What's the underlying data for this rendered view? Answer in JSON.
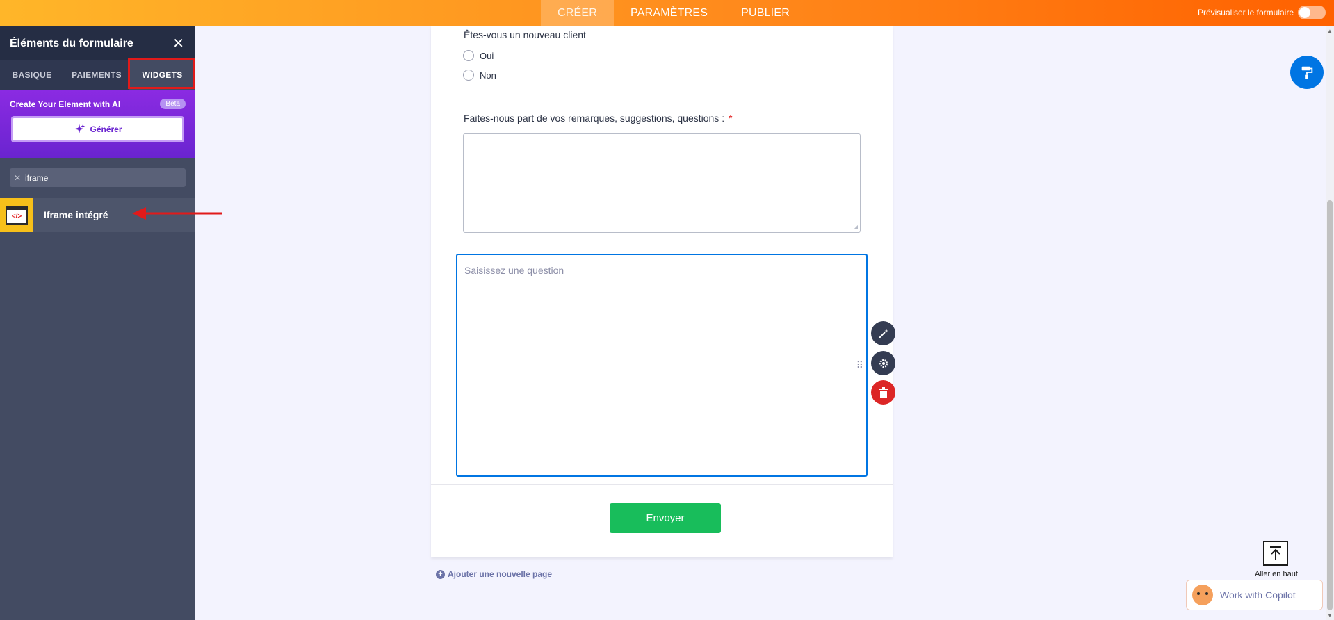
{
  "topbar": {
    "nav": [
      "CRÉER",
      "PARAMÈTRES",
      "PUBLIER"
    ],
    "preview_label": "Prévisualiser le formulaire"
  },
  "sidebar": {
    "title": "Éléments du formulaire",
    "close": "✕",
    "tabs": [
      "BASIQUE",
      "PAIEMENTS",
      "WIDGETS"
    ],
    "ai": {
      "title": "Create Your Element with AI",
      "badge": "Beta",
      "generate_label": "Générer"
    },
    "search": {
      "value": "iframe",
      "clear": "✕"
    },
    "result": {
      "label": "Iframe intégré",
      "icon_text": "</>"
    }
  },
  "form": {
    "q1": {
      "label": "Êtes-vous un nouveau client",
      "options": [
        "Oui",
        "Non"
      ]
    },
    "q2": {
      "label": "Faites-nous part de vos remarques, suggestions, questions :",
      "required_mark": "*"
    },
    "new_question": {
      "placeholder": "Saisissez une question"
    },
    "submit_label": "Envoyer"
  },
  "add_page_label": "Ajouter une nouvelle page",
  "scroll_top_label": "Aller en haut",
  "copilot_label": "Work with Copilot",
  "colors": {
    "accent_orange": "#ff6100",
    "sidebar_bg": "#434b62",
    "ai_purple": "#6a24d0",
    "submit_green": "#18bd5b",
    "focus_blue": "#0075e3",
    "highlight_red": "#e11a1a"
  }
}
